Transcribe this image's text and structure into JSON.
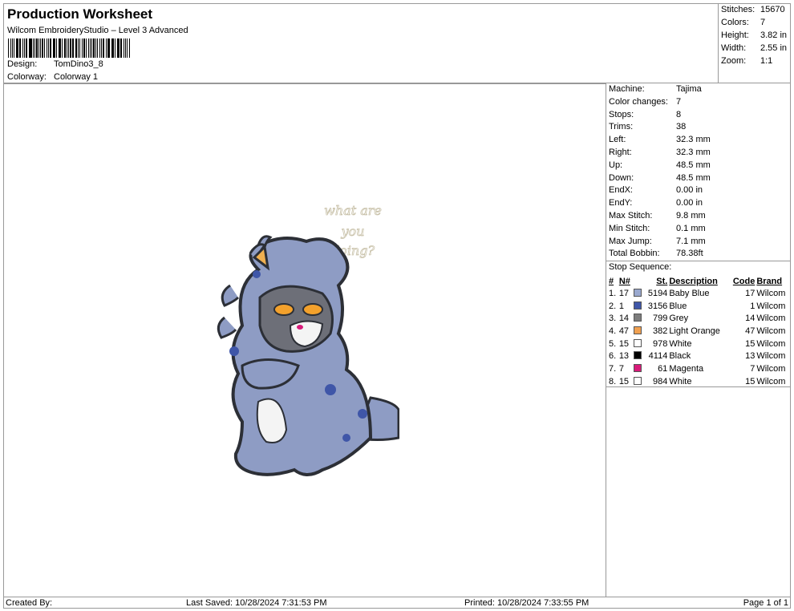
{
  "header": {
    "title": "Production Worksheet",
    "subtitle": "Wilcom EmbroideryStudio – Level 3 Advanced",
    "design_label": "Design:",
    "design_value": "TomDino3_8",
    "colorway_label": "Colorway:",
    "colorway_value": "Colorway 1"
  },
  "stats": {
    "stitches_label": "Stitches:",
    "stitches_value": "15670",
    "colors_label": "Colors:",
    "colors_value": "7",
    "height_label": "Height:",
    "height_value": "3.82 in",
    "width_label": "Width:",
    "width_value": "2.55 in",
    "zoom_label": "Zoom:",
    "zoom_value": "1:1"
  },
  "info": [
    {
      "label": "Machine:",
      "value": "Tajima"
    },
    {
      "label": "Color changes:",
      "value": "7"
    },
    {
      "label": "Stops:",
      "value": "8"
    },
    {
      "label": "Trims:",
      "value": "38"
    },
    {
      "label": "Left:",
      "value": "32.3 mm"
    },
    {
      "label": "Right:",
      "value": "32.3 mm"
    },
    {
      "label": "Up:",
      "value": "48.5 mm"
    },
    {
      "label": "Down:",
      "value": "48.5 mm"
    },
    {
      "label": "EndX:",
      "value": "0.00 in"
    },
    {
      "label": "EndY:",
      "value": "0.00 in"
    },
    {
      "label": "Max Stitch:",
      "value": "9.8 mm"
    },
    {
      "label": "Min Stitch:",
      "value": "0.1 mm"
    },
    {
      "label": "Max Jump:",
      "value": "7.1 mm"
    },
    {
      "label": "Total Bobbin:",
      "value": "78.38ft"
    }
  ],
  "stop_sequence": {
    "title": "Stop Sequence:",
    "headers": {
      "num": "#",
      "n": "N#",
      "st": "St.",
      "desc": "Description",
      "code": "Code",
      "brand": "Brand"
    },
    "rows": [
      {
        "num": "1.",
        "n": "17",
        "color": "#9aa9cf",
        "st": "5194",
        "desc": "Baby Blue",
        "code": "17",
        "brand": "Wilcom"
      },
      {
        "num": "2.",
        "n": "1",
        "color": "#3f56a8",
        "st": "3156",
        "desc": "Blue",
        "code": "1",
        "brand": "Wilcom"
      },
      {
        "num": "3.",
        "n": "14",
        "color": "#7d7d7d",
        "st": "799",
        "desc": "Grey",
        "code": "14",
        "brand": "Wilcom"
      },
      {
        "num": "4.",
        "n": "47",
        "color": "#f0a050",
        "st": "382",
        "desc": "Light Orange",
        "code": "47",
        "brand": "Wilcom"
      },
      {
        "num": "5.",
        "n": "15",
        "color": "#ffffff",
        "st": "978",
        "desc": "White",
        "code": "15",
        "brand": "Wilcom"
      },
      {
        "num": "6.",
        "n": "13",
        "color": "#000000",
        "st": "4114",
        "desc": "Black",
        "code": "13",
        "brand": "Wilcom"
      },
      {
        "num": "7.",
        "n": "7",
        "color": "#d81b7a",
        "st": "61",
        "desc": "Magenta",
        "code": "7",
        "brand": "Wilcom"
      },
      {
        "num": "8.",
        "n": "15",
        "color": "#ffffff",
        "st": "984",
        "desc": "White",
        "code": "15",
        "brand": "Wilcom"
      }
    ]
  },
  "design_text": [
    "what are",
    "you",
    "doing?"
  ],
  "footer": {
    "created_by": "Created By:",
    "last_saved": "Last Saved: 10/28/2024 7:31:53 PM",
    "printed": "Printed: 10/28/2024 7:33:55 PM",
    "page": "Page 1 of 1"
  }
}
